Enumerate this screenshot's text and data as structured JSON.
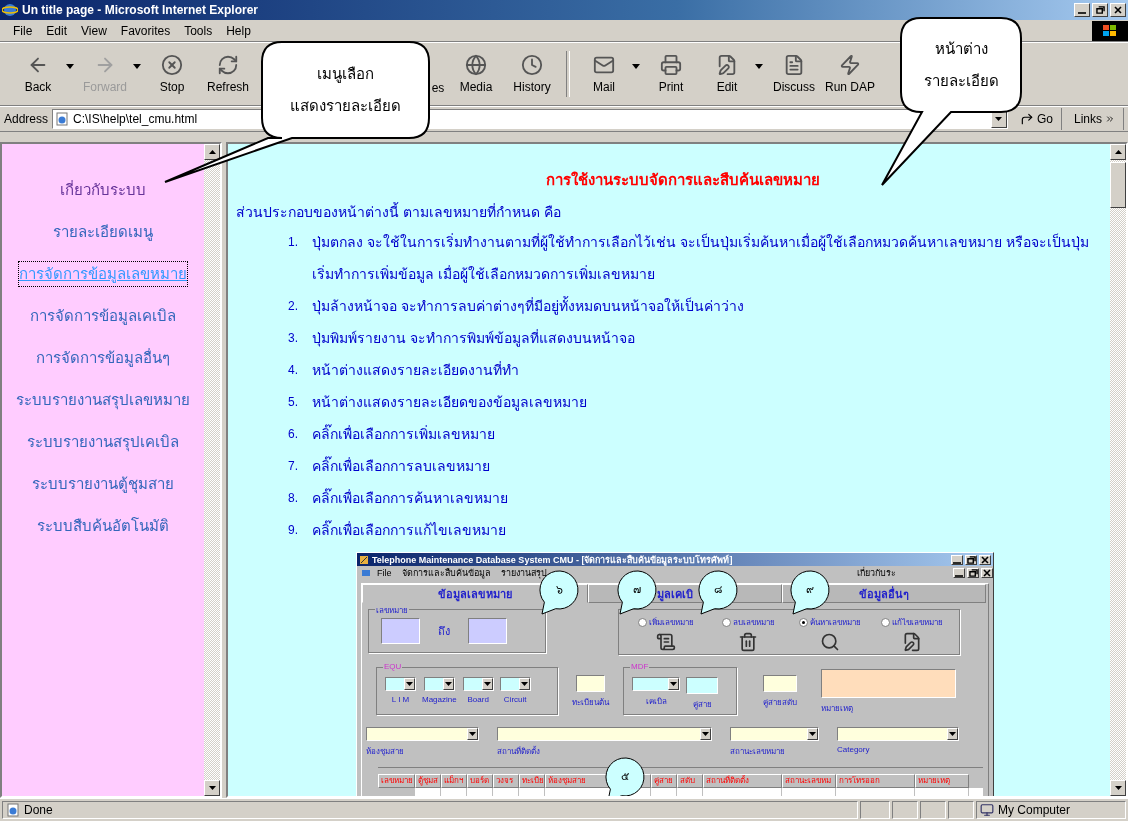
{
  "window": {
    "title": "Un title page - Microsoft Internet Explorer"
  },
  "menu": [
    "File",
    "Edit",
    "View",
    "Favorites",
    "Tools",
    "Help"
  ],
  "toolbar": [
    {
      "label": "Back",
      "disabled": false,
      "dropdown": true
    },
    {
      "label": "Forward",
      "disabled": true,
      "dropdown": true
    },
    {
      "label": "Stop",
      "disabled": false,
      "dropdown": false
    },
    {
      "label": "Refresh",
      "disabled": false,
      "dropdown": false
    },
    {
      "label": "es",
      "disabled": false,
      "dropdown": false
    },
    {
      "label": "Media",
      "disabled": false,
      "dropdown": false
    },
    {
      "label": "History",
      "disabled": false,
      "dropdown": false
    },
    {
      "label": "Mail",
      "disabled": false,
      "dropdown": true
    },
    {
      "label": "Print",
      "disabled": false,
      "dropdown": false
    },
    {
      "label": "Edit",
      "disabled": false,
      "dropdown": true
    },
    {
      "label": "Discuss",
      "disabled": false,
      "dropdown": false
    },
    {
      "label": "Run DAP",
      "disabled": false,
      "dropdown": false
    }
  ],
  "address": {
    "label": "Address",
    "value": "C:\\IS\\help\\tel_cmu.html",
    "go": "Go",
    "links": "Links"
  },
  "sidebar": {
    "items": [
      {
        "label": "เกี่ยวกับระบบ",
        "selected": false,
        "visited": true
      },
      {
        "label": "รายละเอียดเมนู",
        "selected": false,
        "visited": false
      },
      {
        "label": "การจัดการข้อมูลเลขหมาย",
        "selected": true,
        "visited": false
      },
      {
        "label": "การจัดการข้อมูลเคเบิล",
        "selected": false,
        "visited": false
      },
      {
        "label": "การจัดการข้อมูลอื่นๆ",
        "selected": false,
        "visited": false
      },
      {
        "label": "ระบบรายงานสรุปเลขหมาย",
        "selected": false,
        "visited": false
      },
      {
        "label": "ระบบรายงานสรุปเคเบิล",
        "selected": false,
        "visited": false
      },
      {
        "label": "ระบบรายงานตู้ชุมสาย",
        "selected": false,
        "visited": false
      },
      {
        "label": "ระบบสืบค้นอัตโนมัติ",
        "selected": false,
        "visited": false
      }
    ]
  },
  "content": {
    "heading": "การใช้งานระบบจัดการและสืบค้นเลขหมาย",
    "intro": "ส่วนประกอบของหน้าต่างนี้ ตามเลขหมายที่กำหนด คือ",
    "items": [
      {
        "number": "1.",
        "text": "ปุ่มตกลง จะใช้ในการเริ่มทำงานตามที่ผู้ใช้ทำการเลือกไว้เช่น จะเป็นปุ่มเริ่มค้นหาเมื่อผู้ใช้เลือกหมวดค้นหาเลขหมาย หรือจะเป็นปุ่มเริ่มทำการเพิ่มข้อมูล เมื่อผู้ใช้เลือกหมวดการเพิ่มเลขหมาย"
      },
      {
        "number": "2.",
        "text": "ปุ่มล้างหน้าจอ จะทำการลบค่าต่างๆที่มีอยู่ทั้งหมดบนหน้าจอให้เป็นค่าว่าง"
      },
      {
        "number": "3.",
        "text": "ปุ่มพิมพ์รายงาน จะทำการพิมพ์ข้อมูลที่แสดงบนหน้าจอ"
      },
      {
        "number": "4.",
        "text": "หน้าต่างแสดงรายละเอียดงานที่ทำ"
      },
      {
        "number": "5.",
        "text": "หน้าต่างแสดงรายละเอียดของข้อมูลเลขหมาย"
      },
      {
        "number": "6.",
        "text": "คลิ๊กเพื่อเลือกการเพิ่มเลขหมาย"
      },
      {
        "number": "7.",
        "text": "คลิ๊กเพื่อเลือกการลบเลขหมาย"
      },
      {
        "number": "8.",
        "text": "คลิ๊กเพื่อเลือกการค้นหาเลขหมาย"
      },
      {
        "number": "9.",
        "text": "คลิ๊กเพื่อเลือกการแก้ไขเลขหมาย"
      }
    ]
  },
  "app": {
    "title": "Telephone Maintenance Database System CMU - [จัดการและสืบค้นข้อมูลระบบโทรศัพท์]",
    "menu": [
      "File",
      "จัดการและสืบค้นข้อมูล",
      "รายงานสรุป",
      "เกี่ยวกับระ"
    ],
    "tabs": [
      {
        "label": "ข้อมูลเลขหมาย",
        "selected": true
      },
      {
        "label": "มูลเคเบิ",
        "selected": false
      },
      {
        "label": "ข้อมูลอื่นๆ",
        "selected": false
      }
    ],
    "number_range": {
      "label": "เลขหมาย",
      "between": "ถึง"
    },
    "actions": [
      {
        "label": "เพิ่มเลขหมาย",
        "selected": false
      },
      {
        "label": "ลบเลขหมาย",
        "selected": false
      },
      {
        "label": "ค้นหาเลขหมาย",
        "selected": true
      },
      {
        "label": "แก้ไขเลขหมาย",
        "selected": false
      }
    ],
    "equ": {
      "label": "EQU",
      "fields": [
        "L I M",
        "Magazine",
        "Board",
        "Circuit"
      ]
    },
    "register": "ทะเบียนต้น",
    "mdf": {
      "label": "MDF",
      "fields": [
        "เคเบิล",
        "คู่สาย"
      ]
    },
    "pair": "คู่สายสดับ",
    "notes": "หมายเหตุ",
    "filters": [
      "ห้องชุมสาย",
      "สถานที่ติดตั้ง",
      "สถานะเลขหมาย",
      "Category"
    ],
    "grid_columns": [
      "เลขหมาย",
      "ตู้ชุมส",
      "แม็กฯ",
      "บอร์ด",
      "วงจร",
      "ทะเบีย",
      "ห้องชุมสาย",
      "คู่สาย",
      "สดับ",
      "สถานที่ติดตั้ง",
      "สถานะเลขหม",
      "การโทรออก",
      "หมายเหตุ"
    ]
  },
  "markers": [
    "๖",
    "๗",
    "๘",
    "๙",
    "๕"
  ],
  "callouts": [
    {
      "lines": [
        "เมนูเลือก",
        "แสดงรายละเอียด"
      ]
    },
    {
      "lines": [
        "หน้าต่าง",
        "รายละเอียด"
      ]
    }
  ],
  "status_bar": {
    "text": "Done",
    "zone": "My Computer"
  }
}
